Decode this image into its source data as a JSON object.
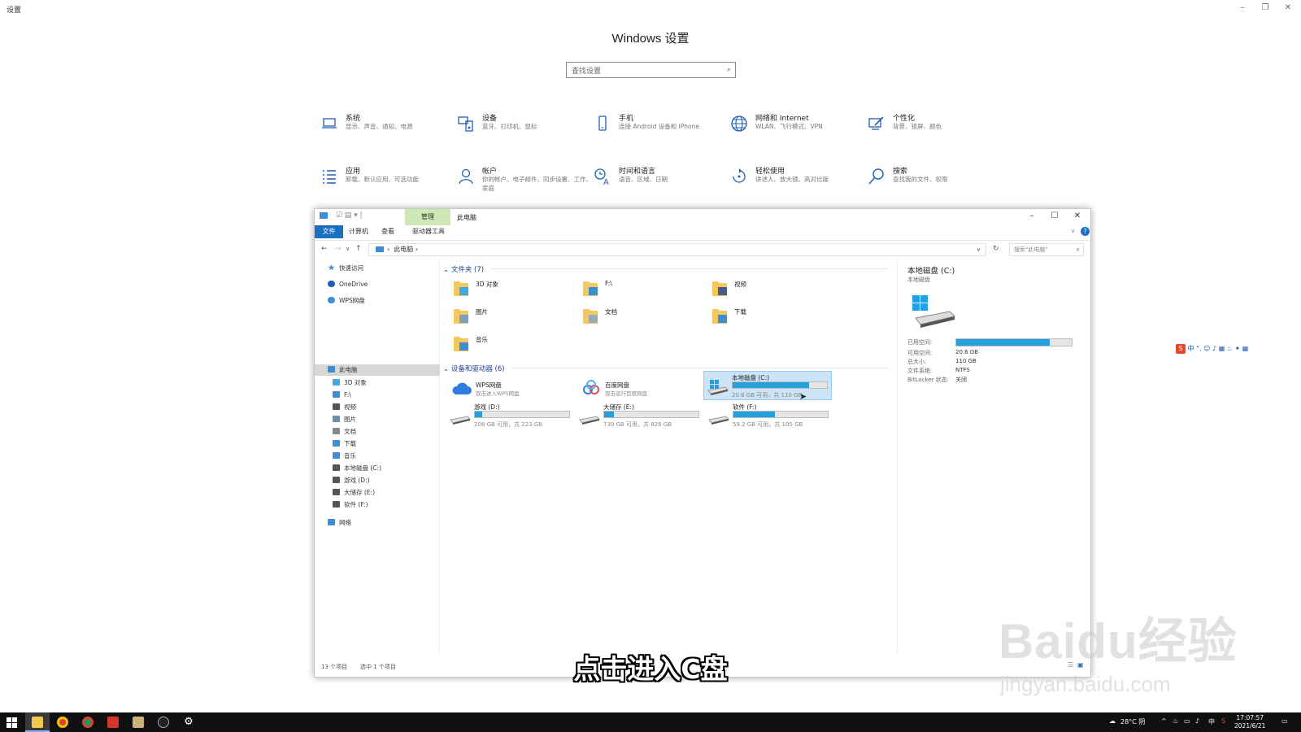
{
  "settings": {
    "window_title": "设置",
    "heading": "Windows 设置",
    "search_placeholder": "查找设置",
    "categories": [
      {
        "title": "系统",
        "subtitle": "显示、声音、通知、电源",
        "icon": "laptop-icon"
      },
      {
        "title": "设备",
        "subtitle": "蓝牙、打印机、鼠标",
        "icon": "devices-icon"
      },
      {
        "title": "手机",
        "subtitle": "连接 Android 设备和 iPhone",
        "icon": "phone-icon"
      },
      {
        "title": "网络和 Internet",
        "subtitle": "WLAN、飞行模式、VPN",
        "icon": "globe-icon"
      },
      {
        "title": "个性化",
        "subtitle": "背景、锁屏、颜色",
        "icon": "personalize-icon"
      },
      {
        "title": "应用",
        "subtitle": "卸载、默认应用、可选功能",
        "icon": "apps-list-icon"
      },
      {
        "title": "帐户",
        "subtitle": "你的帐户、电子邮件、同步设置、工作、家庭",
        "icon": "person-icon"
      },
      {
        "title": "时间和语言",
        "subtitle": "语音、区域、日期",
        "icon": "time-language-icon"
      },
      {
        "title": "轻松使用",
        "subtitle": "讲述人、放大镜、高对比度",
        "icon": "ease-of-access-icon"
      },
      {
        "title": "搜索",
        "subtitle": "查找我的文件、权限",
        "icon": "search-icon"
      }
    ]
  },
  "explorer": {
    "manage_tab": "管理",
    "window_title": "此电脑",
    "ribbon_tabs": [
      "文件",
      "计算机",
      "查看",
      "驱动器工具"
    ],
    "address_path": "此电脑",
    "search_placeholder": "搜索\"此电脑\"",
    "nav": {
      "quick_access": "快速访问",
      "onedrive": "OneDrive",
      "wps": "WPS网盘",
      "this_pc": "此电脑",
      "children": [
        "3D 对象",
        "F:\\",
        "视频",
        "图片",
        "文档",
        "下载",
        "音乐",
        "本地磁盘 (C:)",
        "游戏 (D:)",
        "大储存 (E:)",
        "软件 (F:)"
      ],
      "network": "网络"
    },
    "folders_header": "文件夹 (7)",
    "folders": [
      "3D 对象",
      "F:\\",
      "视频",
      "图片",
      "文档",
      "下载",
      "音乐"
    ],
    "devices_header": "设备和驱动器 (6)",
    "cloud": [
      {
        "name": "WPS网盘",
        "desc": "双击进入WPS网盘"
      },
      {
        "name": "百度网盘",
        "desc": "双击运行百度网盘"
      }
    ],
    "drives": [
      {
        "name": "本地磁盘 (C:)",
        "caption": "20.6 GB 可用，共 110 GB",
        "used_fraction": 0.81
      },
      {
        "name": "游戏 (D:)",
        "caption": "206 GB 可用，共 223 GB",
        "used_fraction": 0.08
      },
      {
        "name": "大储存 (E:)",
        "caption": "739 GB 可用，共 826 GB",
        "used_fraction": 0.1
      },
      {
        "name": "软件 (F:)",
        "caption": "59.2 GB 可用，共 105 GB",
        "used_fraction": 0.44
      }
    ],
    "details": {
      "title": "本地磁盘 (C:)",
      "subtitle": "本地磁盘",
      "used_label": "已用空间:",
      "used_fraction": 0.81,
      "props": [
        {
          "label": "可用空间:",
          "value": "20.6 GB"
        },
        {
          "label": "总大小:",
          "value": "110 GB"
        },
        {
          "label": "文件系统:",
          "value": "NTFS"
        },
        {
          "label": "BitLocker 状态:",
          "value": "关闭"
        }
      ]
    },
    "status": {
      "items": "13 个项目",
      "selected": "选中 1 个项目"
    }
  },
  "ime_toolbar": "中 °, ☺ ♪ ▦ ♨ ✦ ▦",
  "subtitle": "点击进入C盘",
  "watermark": {
    "logo": "Baidu经验",
    "url": "jingyan.baidu.com"
  },
  "taskbar": {
    "weather": "28°C 阴",
    "tray_lang": "中",
    "time": "17:07:57",
    "date": "2021/6/21"
  }
}
